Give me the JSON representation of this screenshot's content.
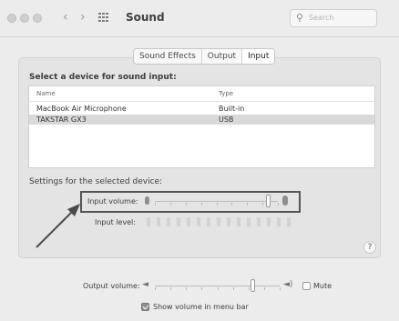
{
  "window": {
    "title": "Sound"
  },
  "search": {
    "placeholder": "Search"
  },
  "tabs": [
    {
      "label": "Sound Effects",
      "active": false
    },
    {
      "label": "Output",
      "active": false
    },
    {
      "label": "Input",
      "active": true
    }
  ],
  "input_devices": {
    "heading": "Select a device for sound input:",
    "columns": [
      "Name",
      "Type"
    ],
    "rows": [
      {
        "name": "MacBook Air Microphone",
        "type": "Built-in",
        "selected": false
      },
      {
        "name": "TAKSTAR GX3",
        "type": "USB",
        "selected": true
      }
    ]
  },
  "device_settings": {
    "heading": "Settings for the selected device:",
    "input_volume_label": "Input volume:",
    "input_volume_value": 0.92,
    "input_level_label": "Input level:",
    "input_level_segments": 15,
    "input_level_active": 0
  },
  "help_button": {
    "label": "?"
  },
  "output": {
    "volume_label": "Output volume:",
    "volume_value": 0.78,
    "mute_label": "Mute",
    "mute_checked": false,
    "show_volume_label": "Show volume in menu bar",
    "show_volume_checked": true
  },
  "colors": {
    "annotation": "#4a4a4a"
  }
}
